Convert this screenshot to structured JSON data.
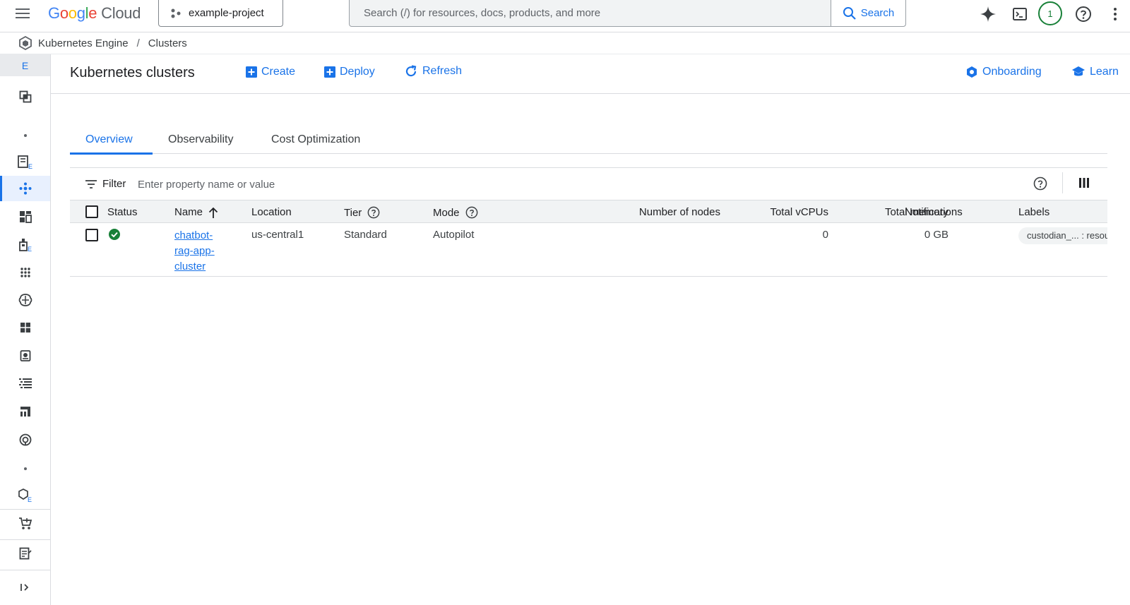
{
  "topbar": {
    "logo_google": [
      "G",
      "o",
      "o",
      "g",
      "l",
      "e"
    ],
    "logo_cloud": "Cloud",
    "project_name": "example-project",
    "search_placeholder": "Search (/) for resources, docs, products, and more",
    "search_button": "Search",
    "avatar_label": "1",
    "icons": [
      "menu-icon",
      "gemini-sparkle-icon",
      "cloud-shell-icon",
      "help-icon",
      "more-vert-icon"
    ]
  },
  "breadcrumb": {
    "items": [
      "Kubernetes Engine",
      "Clusters"
    ],
    "separator": "/"
  },
  "rail": {
    "top_label": "E"
  },
  "header": {
    "title": "Kubernetes clusters",
    "actions": {
      "create": "Create",
      "deploy": "Deploy",
      "refresh": "Refresh",
      "onboarding": "Onboarding",
      "learn": "Learn"
    }
  },
  "tabs": [
    "Overview",
    "Observability",
    "Cost Optimization"
  ],
  "active_tab": "Overview",
  "filter": {
    "label": "Filter",
    "placeholder": "Enter property name or value"
  },
  "table": {
    "columns": {
      "status": "Status",
      "name": "Name",
      "location": "Location",
      "tier": "Tier",
      "mode": "Mode",
      "nodes": "Number of nodes",
      "vcpus": "Total vCPUs",
      "memory": "Total memory",
      "notifications": "Notifications",
      "labels": "Labels"
    },
    "sorted_by": "Name",
    "rows": [
      {
        "status": "ok",
        "name": "chatbot-rag-app-cluster",
        "location": "us-central1",
        "tier": "Standard",
        "mode": "Autopilot",
        "nodes": "",
        "vcpus": "0",
        "memory": "0 GB",
        "notifications": "",
        "labels": "custodian_... : resou"
      }
    ]
  },
  "colors": {
    "accent": "#1a73e8",
    "status_ok": "#188038"
  }
}
